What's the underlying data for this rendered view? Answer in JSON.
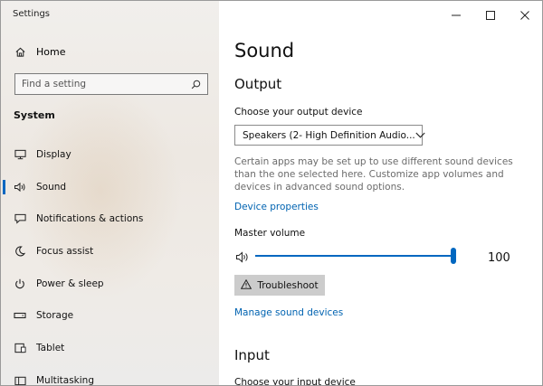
{
  "window": {
    "title": "Settings"
  },
  "sidebar": {
    "home_label": "Home",
    "search_placeholder": "Find a setting",
    "section_label": "System",
    "items": [
      {
        "label": "Display",
        "icon": "monitor-icon"
      },
      {
        "label": "Sound",
        "icon": "speaker-icon",
        "active": true
      },
      {
        "label": "Notifications & actions",
        "icon": "notifications-icon"
      },
      {
        "label": "Focus assist",
        "icon": "moon-icon"
      },
      {
        "label": "Power & sleep",
        "icon": "power-icon"
      },
      {
        "label": "Storage",
        "icon": "storage-icon"
      },
      {
        "label": "Tablet",
        "icon": "tablet-icon"
      },
      {
        "label": "Multitasking",
        "icon": "multitasking-icon"
      }
    ]
  },
  "main": {
    "title": "Sound",
    "output": {
      "heading": "Output",
      "choose_label": "Choose your output device",
      "selected_device": "Speakers (2- High Definition Audio...",
      "description": "Certain apps may be set up to use different sound devices than the one selected here. Customize app volumes and devices in advanced sound options.",
      "device_properties_link": "Device properties",
      "master_volume_label": "Master volume",
      "volume": 100,
      "troubleshoot_label": "Troubleshoot",
      "manage_link": "Manage sound devices"
    },
    "input": {
      "heading": "Input",
      "choose_label": "Choose your input device"
    }
  },
  "colors": {
    "accent": "#0067c0",
    "link": "#0063b1"
  }
}
